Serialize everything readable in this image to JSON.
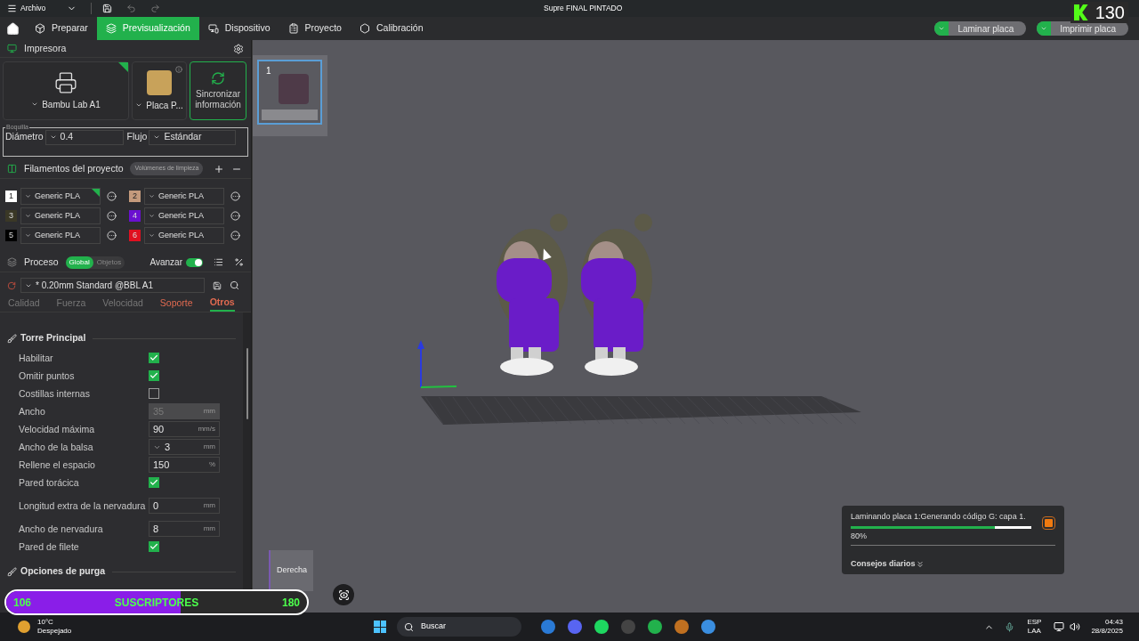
{
  "title_bar": {
    "menu": "Archivo",
    "title": "Supre FINAL PINTADO"
  },
  "nav": {
    "tabs": [
      {
        "label": "Preparar",
        "selected": false
      },
      {
        "label": "Previsualización",
        "selected": true
      },
      {
        "label": "Dispositivo",
        "selected": false
      },
      {
        "label": "Proyecto",
        "selected": false
      },
      {
        "label": "Calibración",
        "selected": false
      }
    ],
    "actions": [
      "Laminar placa",
      "Imprimir placa"
    ]
  },
  "printer": {
    "title": "Impresora",
    "printer_name": "Bambu Lab A1",
    "plate": "Placa P...",
    "sync": "Sincronizar información",
    "nozzle": {
      "legend": "Boquilla",
      "diameter_label": "Diámetro",
      "diameter": "0.4",
      "flow_label": "Flujo",
      "flow": "Estándar"
    }
  },
  "filaments": {
    "title": "Filamentos del proyecto",
    "badge": "Volúmenes de limpieza",
    "items": [
      {
        "number": "1",
        "name": "Generic PLA",
        "color": "#ffffff",
        "selected": true
      },
      {
        "number": "2",
        "name": "Generic PLA",
        "color": "#c49a7c",
        "selected": false
      },
      {
        "number": "3",
        "name": "Generic PLA",
        "color": "#3a3826",
        "selected": false
      },
      {
        "number": "4",
        "name": "Generic PLA",
        "color": "#6a10d0",
        "selected": false
      },
      {
        "number": "5",
        "name": "Generic PLA",
        "color": "#000000",
        "selected": false
      },
      {
        "number": "6",
        "name": "Generic PLA",
        "color": "#e01020",
        "selected": false
      }
    ]
  },
  "process": {
    "title": "Proceso",
    "scope_tabs": [
      {
        "label": "Global",
        "selected": true
      },
      {
        "label": "Objetos",
        "selected": false
      }
    ],
    "advance_label": "Avanzar",
    "advance_on": true,
    "preset": "* 0.20mm Standard @BBL A1",
    "tabs": [
      {
        "label": "Calidad",
        "selected": false,
        "modified": false
      },
      {
        "label": "Fuerza",
        "selected": false,
        "modified": false
      },
      {
        "label": "Velocidad",
        "selected": false,
        "modified": false
      },
      {
        "label": "Soporte",
        "selected": false,
        "modified": true
      },
      {
        "label": "Otros",
        "selected": true,
        "modified": true
      }
    ],
    "section": {
      "title": "Torre Principal",
      "settings": [
        {
          "kind": "checkbox",
          "label": "Habilitar",
          "checked": true
        },
        {
          "kind": "checkbox",
          "label": "Omitir puntos",
          "checked": true
        },
        {
          "kind": "checkbox",
          "label": "Costillas internas",
          "checked": false
        },
        {
          "kind": "number",
          "label": "Ancho",
          "value": "35",
          "unit": "mm",
          "disabled": true
        },
        {
          "kind": "number",
          "label": "Velocidad máxima",
          "value": "90",
          "unit": "mm/s",
          "disabled": false
        },
        {
          "kind": "dropdown",
          "label": "Ancho de la balsa",
          "value": "3",
          "unit": "mm",
          "disabled": false
        },
        {
          "kind": "number",
          "label": "Rellene el espacio",
          "value": "150",
          "unit": "%",
          "disabled": false
        },
        {
          "kind": "checkbox",
          "label": "Pared torácica",
          "checked": true
        },
        {
          "kind": "number",
          "label": "Longitud extra de la nervadura",
          "value": "0",
          "unit": "mm",
          "disabled": false
        },
        {
          "kind": "number",
          "label": "Ancho de nervadura",
          "value": "8",
          "unit": "mm",
          "disabled": false
        },
        {
          "kind": "checkbox",
          "label": "Pared de filete",
          "checked": true
        }
      ]
    },
    "next_section": "Opciones de purga"
  },
  "plates": [
    {
      "number": "1",
      "selected": true
    }
  ],
  "viewport": {
    "view_label": "Derecha"
  },
  "slicing": {
    "message": "Laminando placa 1:Generando código G: capa 1.",
    "level": 0.8,
    "percent": "80%",
    "tips": "Consejos diarios"
  },
  "overlay": {
    "counter": "130",
    "subscribers": {
      "start": "106",
      "label": "SUSCRIPTORES",
      "goal": "180",
      "level": 0.58
    }
  },
  "taskbar": {
    "temperature": "10°C",
    "condition": "Despejado",
    "search": "Buscar",
    "language": "ESP",
    "layout": "LAA",
    "time": "04:43",
    "date": "28/8/2025"
  }
}
